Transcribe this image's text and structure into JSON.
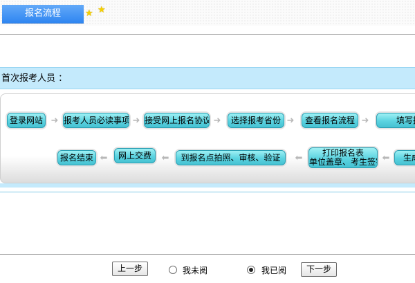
{
  "header": {
    "title": "报名流程",
    "stars": [
      "star-icon",
      "star-icon"
    ]
  },
  "section": {
    "title": "首次报考人员 ："
  },
  "flow": {
    "row1": [
      "登录网站",
      "报考人员必读事项",
      "接受网上报名协议",
      "选择报考省份",
      "查看报名流程",
      "填写报"
    ],
    "row2": [
      "生成",
      "打印报名表",
      "单位盖章、考生签字",
      "到报名点拍照、审核、验证",
      "网上交费",
      "报名结束"
    ]
  },
  "nav": {
    "prev_label": "上一步",
    "next_label": "下一步",
    "radio_unread_label": "我未阅",
    "radio_read_label": "我已阅",
    "selected": "我已阅"
  },
  "colors": {
    "accent_blue": "#2f86f1",
    "section_bg": "#c4eafc",
    "step_cyan": "#5bd3e0"
  }
}
